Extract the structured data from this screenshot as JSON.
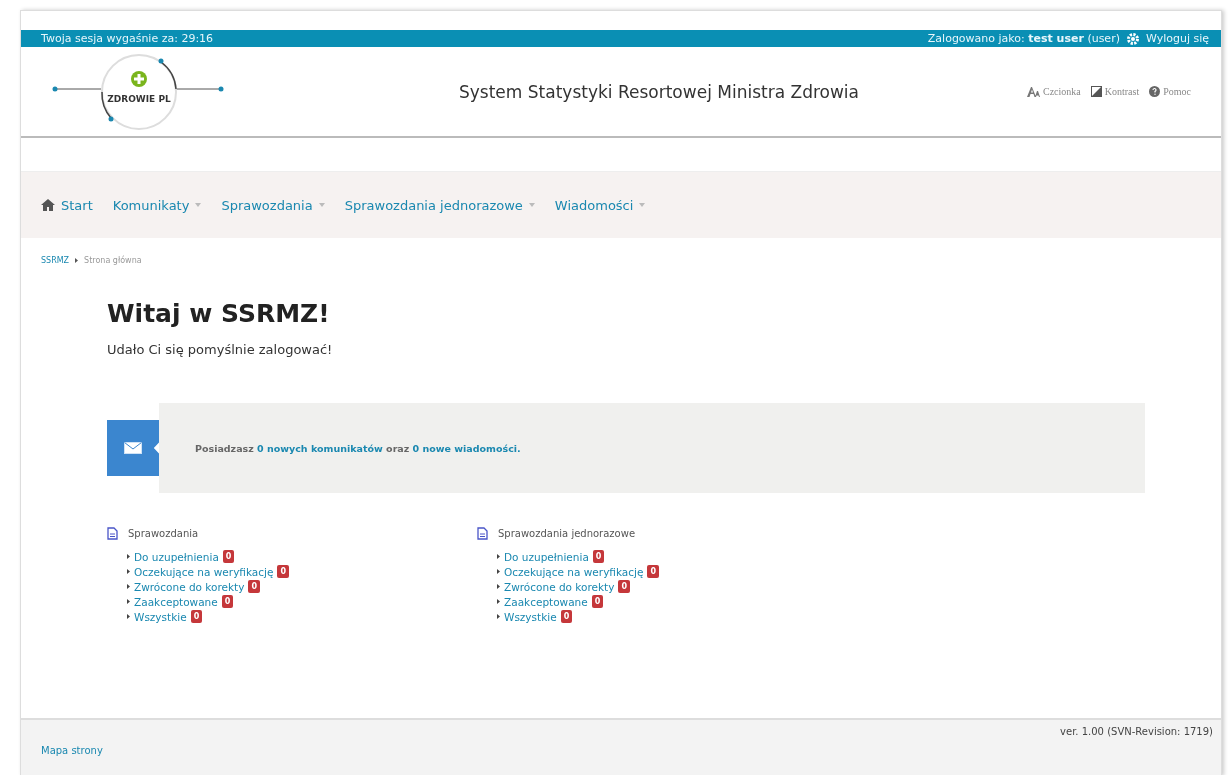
{
  "top_bar": {
    "session": "Twoja sesja wygaśnie za: 29:16",
    "logged_prefix": "Zalogowano jako:",
    "user": "test user",
    "role": "(user)",
    "logout": "Wyloguj się"
  },
  "header": {
    "logo_text": "ZDROWIE PL",
    "title": "System Statystyki Resortowej Ministra Zdrowia",
    "tools": [
      {
        "kind": "font",
        "label": "Czcionka"
      },
      {
        "kind": "contrast",
        "label": "Kontrast"
      },
      {
        "kind": "help",
        "label": "Pomoc"
      }
    ]
  },
  "nav": [
    {
      "label": "Start",
      "home": true,
      "dropdown": false
    },
    {
      "label": "Komunikaty",
      "home": false,
      "dropdown": true
    },
    {
      "label": "Sprawozdania",
      "home": false,
      "dropdown": true
    },
    {
      "label": "Sprawozdania jednorazowe",
      "home": false,
      "dropdown": true
    },
    {
      "label": "Wiadomości",
      "home": false,
      "dropdown": true
    }
  ],
  "breadcrumb": [
    "SSRMZ",
    "Strona główna"
  ],
  "heading": "Witaj w SSRMZ!",
  "subheading": "Udało Ci się pomyślnie zalogować!",
  "message": [
    {
      "kind": "plain",
      "text": "Posiadzasz"
    },
    {
      "kind": "link",
      "text": "0 nowych komunikatów"
    },
    {
      "kind": "plain",
      "text": "oraz"
    },
    {
      "kind": "link",
      "text": "0 nowe wiadomości."
    }
  ],
  "sections": [
    {
      "title": "Sprawozdania",
      "items": [
        {
          "label": "Do uzupełnienia",
          "count": "0"
        },
        {
          "label": "Oczekujące na weryfikację",
          "count": "0"
        },
        {
          "label": "Zwrócone do korekty",
          "count": "0"
        },
        {
          "label": "Zaakceptowane",
          "count": "0"
        },
        {
          "label": "Wszystkie",
          "count": "0"
        }
      ]
    },
    {
      "title": "Sprawozdania jednorazowe",
      "items": [
        {
          "label": "Do uzupełnienia",
          "count": "0"
        },
        {
          "label": "Oczekujące na weryfikację",
          "count": "0"
        },
        {
          "label": "Zwrócone do korekty",
          "count": "0"
        },
        {
          "label": "Zaakceptowane",
          "count": "0"
        },
        {
          "label": "Wszystkie",
          "count": "0"
        }
      ]
    }
  ],
  "footer": {
    "version": "ver. 1.00 (SVN-Revision: 1719)",
    "sitemap": "Mapa strony"
  }
}
